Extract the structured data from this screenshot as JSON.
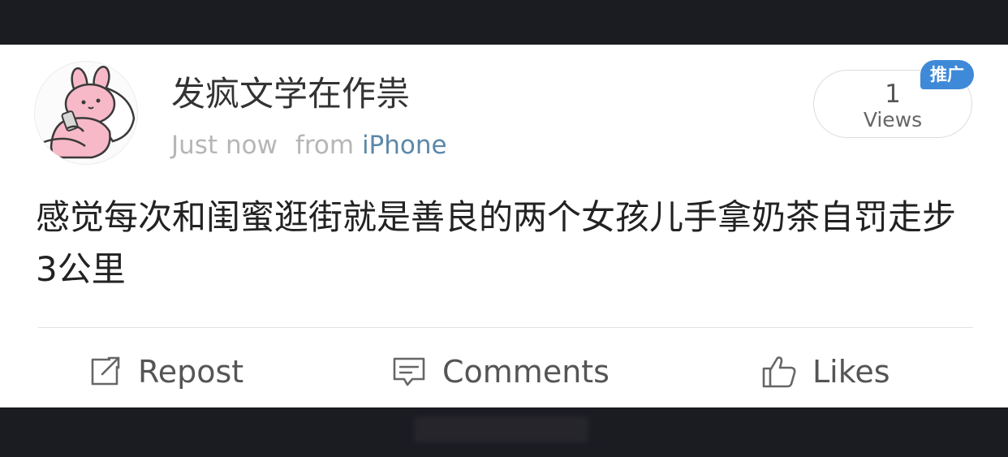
{
  "post": {
    "username": "发疯文学在作祟",
    "time": "Just now",
    "from_label": "from",
    "device": "iPhone",
    "text": "感觉每次和闺蜜逛街就是善良的两个女孩儿手拿奶茶自罚走步 3公里",
    "avatar_icon": "pink-bunny-avatar-icon"
  },
  "views": {
    "count": "1",
    "label": "Views",
    "badge": "推广",
    "badge_color": "#3e8ad8"
  },
  "actions": {
    "repost": {
      "label": "Repost",
      "icon": "repost-icon"
    },
    "comments": {
      "label": "Comments",
      "icon": "comment-icon"
    },
    "likes": {
      "label": "Likes",
      "icon": "thumbs-up-icon"
    }
  },
  "colors": {
    "device_link": "#5b88a8",
    "bars": "#1b1b22"
  }
}
